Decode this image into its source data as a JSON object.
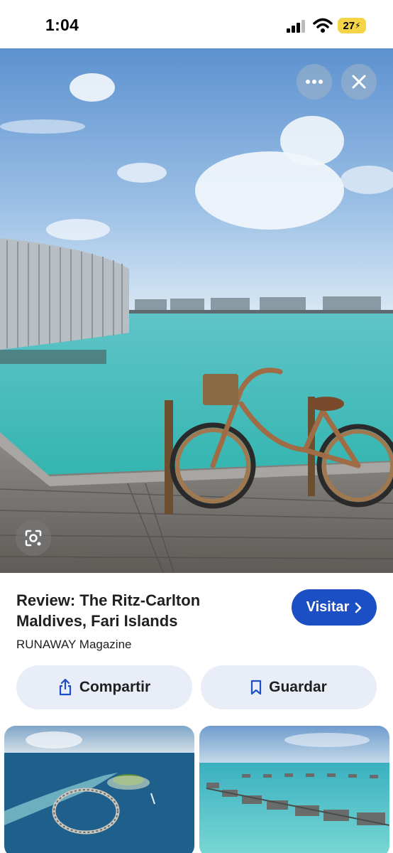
{
  "status_bar": {
    "time": "1:04",
    "battery": "27"
  },
  "hero": {
    "image": "overwater-villas-bicycle-photo",
    "more_icon": "more-horizontal-icon",
    "close_icon": "close-icon",
    "lens_icon": "lens-search-icon"
  },
  "result": {
    "title_line1": "Review: The Ritz-Carlton",
    "title_line2": "Maldives, Fari Islands",
    "source": "RUNAWAY Magazine",
    "visit_label": "Visitar",
    "share_label": "Compartir",
    "save_label": "Guardar",
    "accent_color": "#1d4fc4"
  },
  "related": [
    {
      "image": "aerial-island-resort-photo"
    },
    {
      "image": "overwater-villas-row-photo"
    }
  ]
}
